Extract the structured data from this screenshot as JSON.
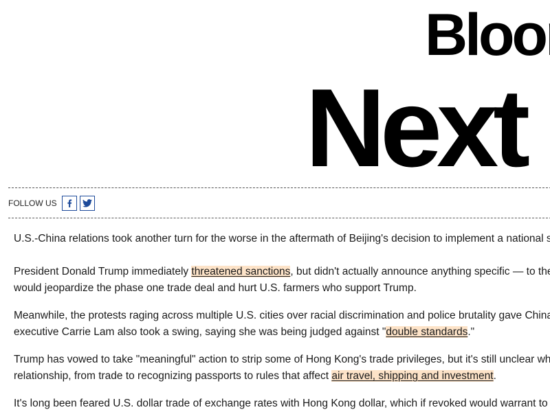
{
  "masthead": {
    "brand": "Bloom",
    "newsletter": "Next"
  },
  "follow": {
    "label": "FOLLOW US",
    "facebook_icon": "facebook-icon",
    "twitter_icon": "twitter-icon",
    "accent": "#1d4a9a"
  },
  "article": {
    "p1": {
      "text": "U.S.-China relations took another turn for the worse in the aftermath of Beijing's decision to implement a national s"
    },
    "p2": {
      "before": "President Donald Trump immediately ",
      "link": "threatened sanctions",
      "after": ", but didn't actually announce anything specific — to the",
      "line2": "would jeopardize the phase one trade deal and hurt U.S. farmers who support Trump."
    },
    "p3": {
      "line1": "Meanwhile, the protests raging across multiple U.S. cities over racial discrimination and police brutality gave China",
      "line2_before": "executive Carrie Lam also took a swing, saying she was being judged against \"",
      "link": "double standards",
      "line2_after": ".\""
    },
    "p4": {
      "line1": "Trump has vowed to take \"meaningful\" action to strip some of Hong Kong's trade privileges, but it's still unclear wh",
      "line2_before": "relationship, from trade to recognizing passports to rules that affect ",
      "link": "air travel, shipping and investment",
      "line2_after": "."
    },
    "p5": {
      "text": "It's long been feared U.S. dollar trade of exchange rates with Hong Kong dollar, which if revoked would warrant to ade"
    },
    "highlight_color": "#fde3c8"
  }
}
